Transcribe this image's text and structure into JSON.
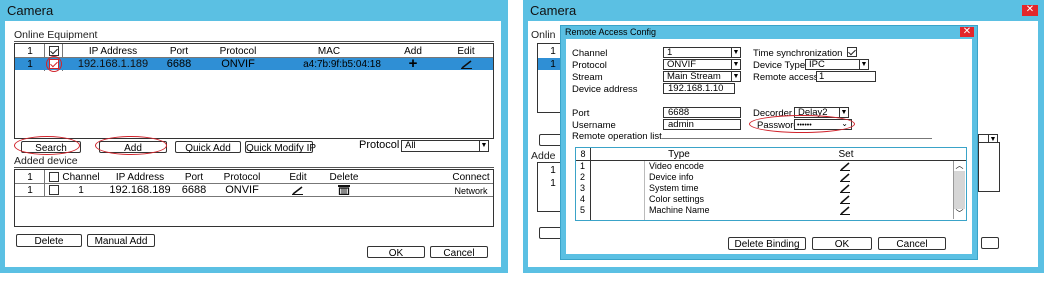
{
  "left": {
    "window_title": "Camera",
    "online_equipment": {
      "label": "Online Equipment",
      "columns": [
        "1",
        "",
        "IP Address",
        "Port",
        "Protocol",
        "MAC",
        "Add",
        "Edit"
      ],
      "rows": [
        {
          "index": "1",
          "ip": "192.168.1.189",
          "port": "6688",
          "protocol": "ONVIF",
          "mac": "a4:7b:9f:b5:04:18",
          "add": "+"
        }
      ]
    },
    "buttons": {
      "search": "Search",
      "add": "Add",
      "quick_add": "Quick Add",
      "quick_modify_ip": "Quick Modify IP",
      "delete": "Delete",
      "manual_add": "Manual Add",
      "ok": "OK",
      "cancel": "Cancel"
    },
    "protocol": {
      "label": "Protocol",
      "value": "All"
    },
    "added_device": {
      "label": "Added device",
      "columns": [
        "1",
        "",
        "Channel",
        "IP Address",
        "Port",
        "Protocol",
        "Edit",
        "Delete",
        "Connect"
      ],
      "rows": [
        {
          "index": "1",
          "channel": "1",
          "ip": "192.168.189",
          "port": "6688",
          "protocol": "ONVIF",
          "connect": "Network"
        }
      ]
    }
  },
  "right": {
    "window_title": "Camera",
    "background_label_online": "Onlin",
    "background_label_added": "Adde",
    "background_cell_1a": "1",
    "background_cell_1b": "1",
    "background_cell_1c": "1",
    "background_cell_1d": "1",
    "dialog": {
      "title": "Remote Access Config",
      "channel": {
        "label": "Channel",
        "value": "1"
      },
      "protocol": {
        "label": "Protocol",
        "value": "ONVIF"
      },
      "stream": {
        "label": "Stream",
        "value": "Main Stream"
      },
      "device_address": {
        "label": "Device address",
        "value": "192.168.1.10"
      },
      "time_sync": {
        "label": "Time synchronization",
        "checked": true
      },
      "device_type": {
        "label": "Device Type",
        "value": "IPC"
      },
      "remote_access": {
        "label": "Remote access",
        "value": "1"
      },
      "port": {
        "label": "Port",
        "value": "6688"
      },
      "username": {
        "label": "Username",
        "value": "admin"
      },
      "decoder": {
        "label": "Decorder",
        "value": "Delay2"
      },
      "password": {
        "label": "Password",
        "value": "••••••"
      },
      "remote_operation_list": {
        "label": "Remote operation list",
        "columns": [
          "8",
          "Type",
          "Set"
        ],
        "rows": [
          {
            "index": "1",
            "type": "Video encode"
          },
          {
            "index": "2",
            "type": "Device info"
          },
          {
            "index": "3",
            "type": "System time"
          },
          {
            "index": "4",
            "type": "Color settings"
          },
          {
            "index": "5",
            "type": "Machine Name"
          }
        ]
      },
      "buttons": {
        "delete_binding": "Delete Binding",
        "ok": "OK",
        "cancel": "Cancel"
      }
    }
  },
  "colors": {
    "window_frame": "#5bc0e3",
    "selection": "#2f8fd5",
    "highlight_ring": "#d1242c",
    "close_button": "#e3262b"
  }
}
